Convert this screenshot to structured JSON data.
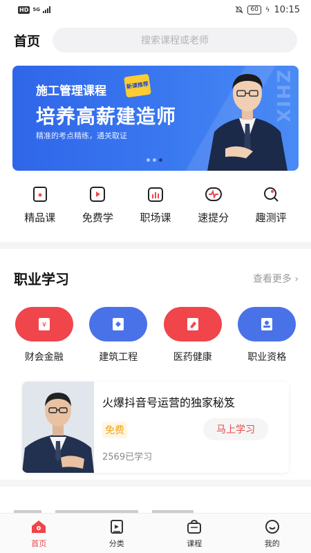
{
  "status_bar": {
    "hd": "HD",
    "network": "5G",
    "battery": "60",
    "time": "10:15"
  },
  "header": {
    "title": "首页",
    "search_placeholder": "搜索课程或老师"
  },
  "banner": {
    "subtitle": "施工管理课程",
    "tag": "新课推荐",
    "title": "培养高薪建造师",
    "description": "精准的考点精练，通关取证",
    "watermark": "ZHIX",
    "slide_count": 3,
    "active_slide": 3
  },
  "quick_menu": [
    {
      "label": "精品课",
      "icon": "premium-course-icon"
    },
    {
      "label": "免费学",
      "icon": "free-learn-icon"
    },
    {
      "label": "职场课",
      "icon": "career-course-icon"
    },
    {
      "label": "速提分",
      "icon": "score-boost-icon"
    },
    {
      "label": "趣测评",
      "icon": "quiz-icon"
    }
  ],
  "career_section": {
    "title": "职业学习",
    "more_label": "查看更多"
  },
  "categories": [
    {
      "label": "财会金融",
      "icon": "finance-icon",
      "color": "#f0454b"
    },
    {
      "label": "建筑工程",
      "icon": "construction-icon",
      "color": "#4a72e8"
    },
    {
      "label": "医药健康",
      "icon": "medicine-icon",
      "color": "#f0454b"
    },
    {
      "label": "职业资格",
      "icon": "qualification-icon",
      "color": "#4a72e8"
    }
  ],
  "course_card": {
    "title": "火爆抖音号运营的独家秘笈",
    "price": "免费",
    "action": "马上学习",
    "learners": "2569已学习"
  },
  "bottom_nav": [
    {
      "label": "首页",
      "icon": "home-icon",
      "active": true
    },
    {
      "label": "分类",
      "icon": "category-icon",
      "active": false
    },
    {
      "label": "课程",
      "icon": "course-bag-icon",
      "active": false
    },
    {
      "label": "我的",
      "icon": "profile-icon",
      "active": false
    }
  ],
  "colors": {
    "accent": "#e84848",
    "banner_blue": "#3a78f0"
  }
}
